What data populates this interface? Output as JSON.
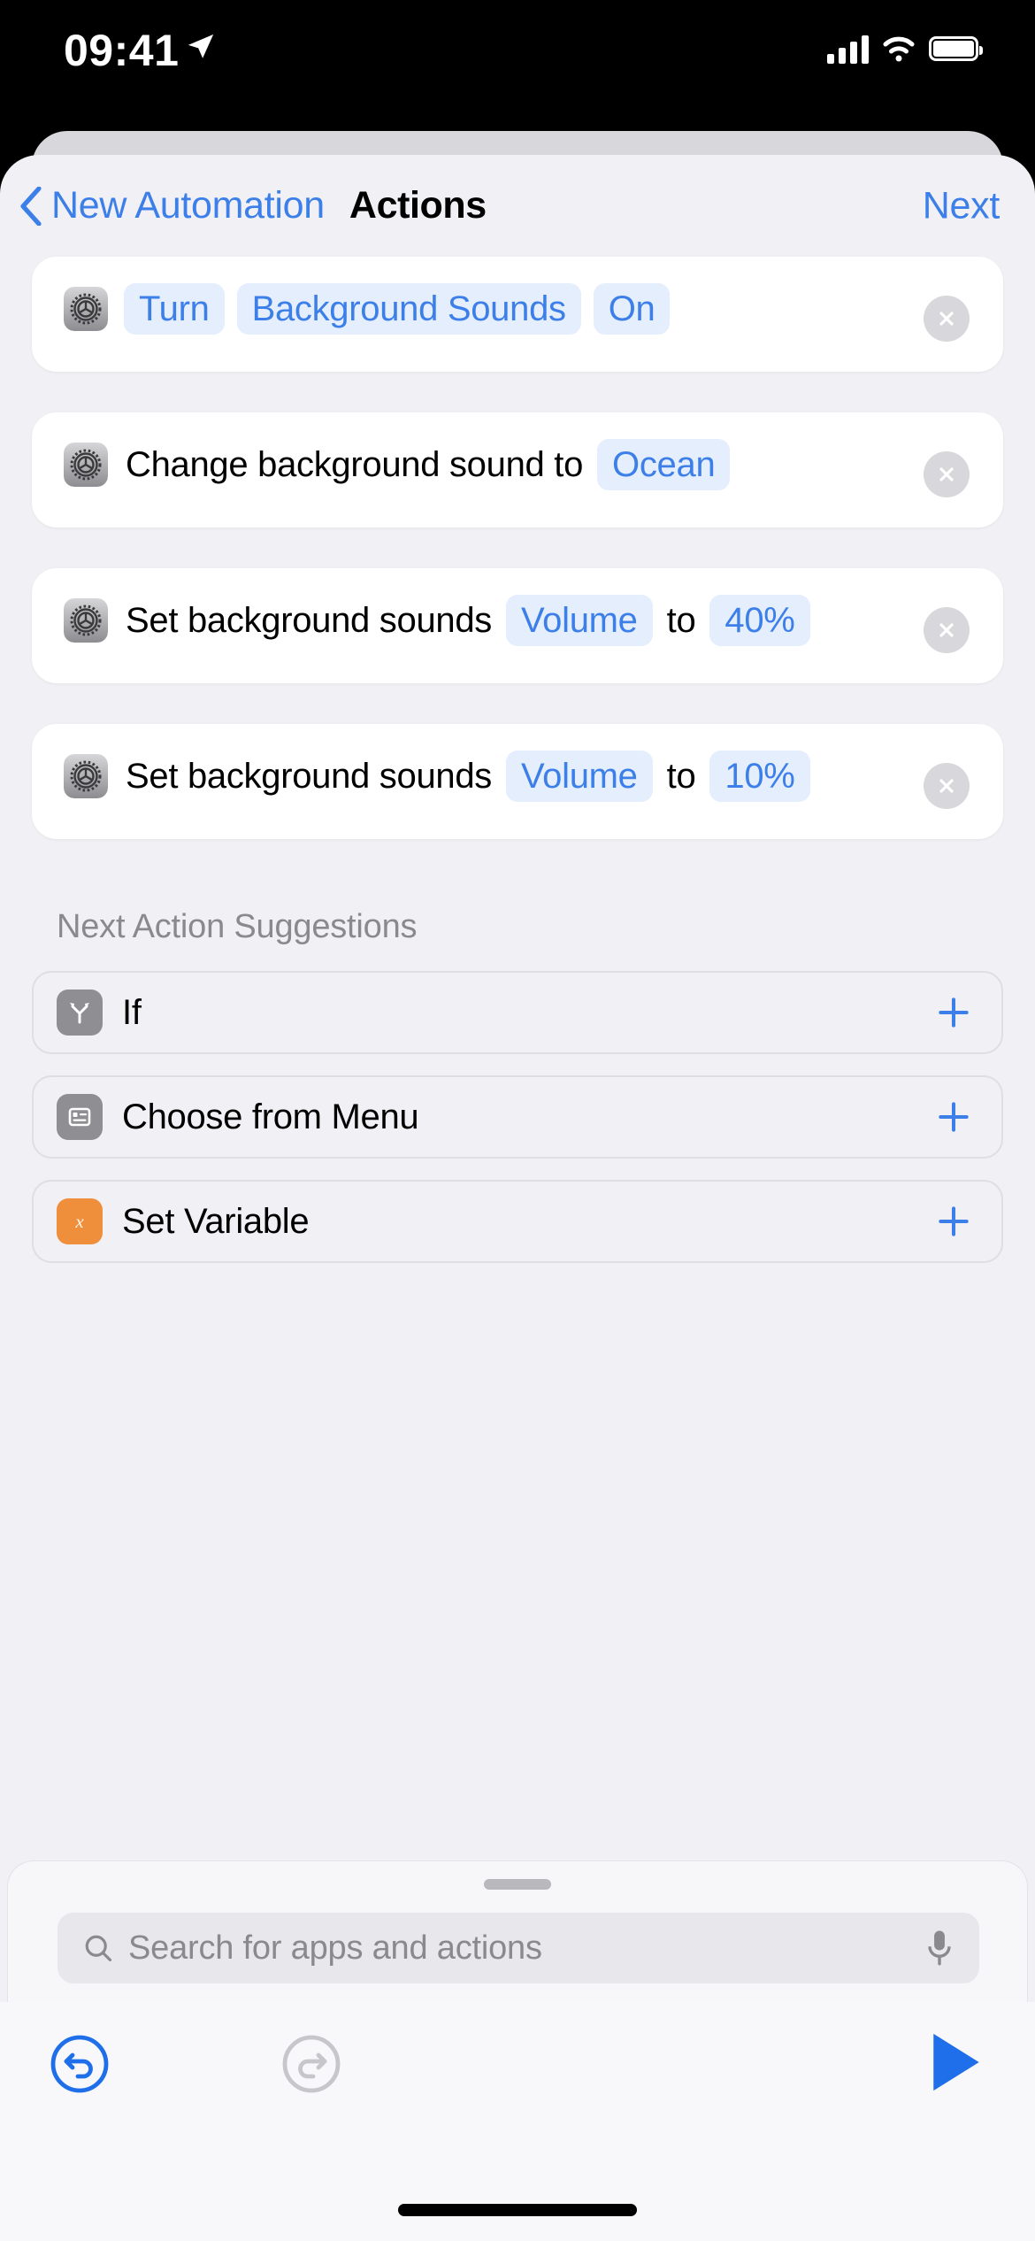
{
  "status_bar": {
    "time": "09:41",
    "location_icon": "location-arrow-icon",
    "cellular_icon": "cellular-bars-icon",
    "wifi_icon": "wifi-icon",
    "battery_icon": "battery-full-icon"
  },
  "nav": {
    "back_icon": "chevron-left-icon",
    "back_label": "New Automation",
    "title": "Actions",
    "next_label": "Next"
  },
  "accent_color": "#3d7fe8",
  "pill_bg_color": "#e4eefc",
  "sheet_bg_color": "#f1f1f5",
  "actions": [
    {
      "app_icon": "settings-gear-icon",
      "close_icon": "close-circle-icon",
      "tokens": [
        {
          "text": "Turn",
          "style": "pill"
        },
        {
          "text": "Background Sounds",
          "style": "pill"
        },
        {
          "text": "On",
          "style": "pill"
        }
      ]
    },
    {
      "app_icon": "settings-gear-icon",
      "close_icon": "close-circle-icon",
      "tokens": [
        {
          "text": "Change background sound to",
          "style": "plain"
        },
        {
          "text": "Ocean",
          "style": "pill"
        }
      ]
    },
    {
      "app_icon": "settings-gear-icon",
      "close_icon": "close-circle-icon",
      "tokens": [
        {
          "text": "Set background sounds",
          "style": "plain"
        },
        {
          "text": "Volume",
          "style": "pill"
        },
        {
          "text": "to",
          "style": "plain"
        },
        {
          "text": "40%",
          "style": "pill"
        }
      ]
    },
    {
      "app_icon": "settings-gear-icon",
      "close_icon": "close-circle-icon",
      "tokens": [
        {
          "text": "Set background sounds",
          "style": "plain"
        },
        {
          "text": "Volume",
          "style": "pill"
        },
        {
          "text": "to",
          "style": "plain"
        },
        {
          "text": "10%",
          "style": "pill"
        }
      ]
    }
  ],
  "suggestions": {
    "header": "Next Action Suggestions",
    "items": [
      {
        "label": "If",
        "icon": "branch-arrow-icon",
        "icon_color": "#8e8e93",
        "add_icon": "plus-icon"
      },
      {
        "label": "Choose from Menu",
        "icon": "menu-list-icon",
        "icon_color": "#8e8e93",
        "add_icon": "plus-icon"
      },
      {
        "label": "Set Variable",
        "icon": "variable-x-icon",
        "icon_color": "#ef8f3b",
        "add_icon": "plus-icon"
      }
    ]
  },
  "search": {
    "grabber": "sheet-grabber",
    "icon": "search-icon",
    "placeholder": "Search for apps and actions",
    "value": "",
    "mic_icon": "microphone-icon"
  },
  "toolbar": {
    "undo_icon": "undo-icon",
    "undo_enabled": "true",
    "redo_icon": "redo-icon",
    "redo_enabled": "false",
    "play_icon": "play-icon"
  }
}
